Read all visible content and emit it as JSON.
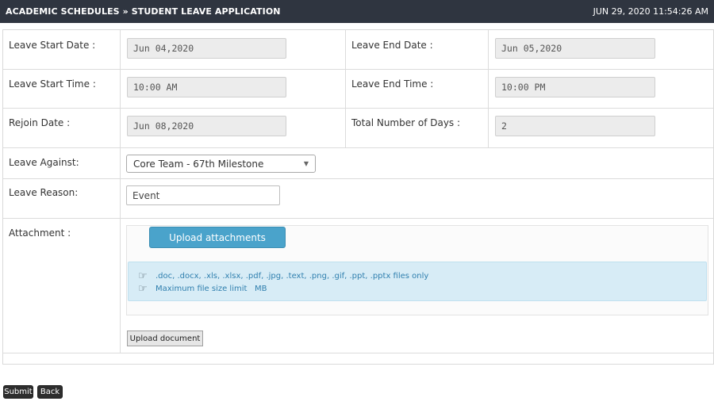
{
  "header": {
    "title": "ACADEMIC SCHEDULES » STUDENT LEAVE APPLICATION",
    "datetime": "JUN 29, 2020  11:54:26 AM"
  },
  "form": {
    "leave_start_date": {
      "label": "Leave Start Date :",
      "value": "Jun 04,2020"
    },
    "leave_end_date": {
      "label": "Leave End Date :",
      "value": "Jun 05,2020"
    },
    "leave_start_time": {
      "label": "Leave Start Time :",
      "value": "10:00 AM"
    },
    "leave_end_time": {
      "label": "Leave End Time :",
      "value": "10:00 PM"
    },
    "rejoin_date": {
      "label": "Rejoin Date :",
      "value": "Jun 08,2020"
    },
    "total_days": {
      "label": "Total Number of Days :",
      "value": "2"
    },
    "leave_against": {
      "label": "Leave Against:",
      "value": "Core Team - 67th Milestone"
    },
    "leave_reason": {
      "label": "Leave Reason:",
      "value": "Event"
    },
    "attachment": {
      "label": "Attachment :",
      "upload_label": "Upload attachments",
      "info_formats": ".doc, .docx, .xls, .xlsx, .pdf, .jpg, .text, .png, .gif, .ppt, .pptx files only",
      "info_size": "Maximum file size limit   MB",
      "upload_document_label": "Upload document"
    }
  },
  "actions": {
    "submit_label": "Submit",
    "back_label": "Back"
  },
  "icons": {
    "info_hand": "pointing-hand-icon",
    "dropdown": "chevron-down-icon"
  }
}
